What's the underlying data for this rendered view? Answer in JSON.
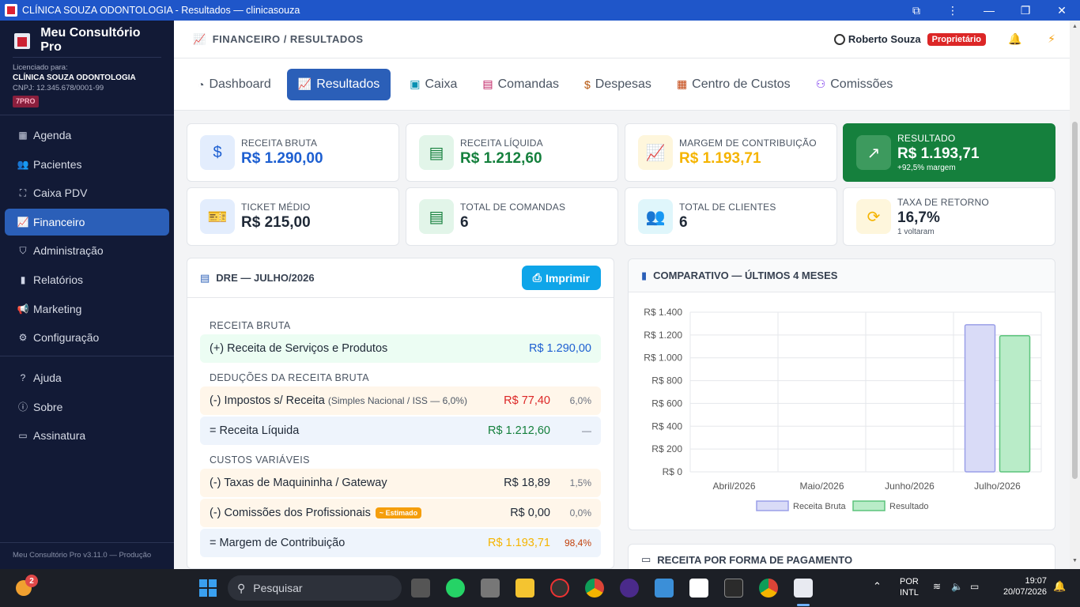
{
  "window": {
    "title": "CLÍNICA SOUZA ODONTOLOGIA - Resultados — clinicasouza"
  },
  "sidebar": {
    "brand": "Meu Consultório Pro",
    "license_label": "Licenciado para:",
    "clinic": "CLÍNICA SOUZA ODONTOLOGIA",
    "cnpj": "CNPJ: 12.345.678/0001-99",
    "plan": "7PRO",
    "items": [
      {
        "label": "Agenda",
        "icon": "calendar-icon"
      },
      {
        "label": "Pacientes",
        "icon": "users-icon"
      },
      {
        "label": "Caixa PDV",
        "icon": "cash-register-icon"
      },
      {
        "label": "Financeiro",
        "icon": "chart-line-icon"
      },
      {
        "label": "Administração",
        "icon": "shield-icon"
      },
      {
        "label": "Relatórios",
        "icon": "bar-chart-icon"
      },
      {
        "label": "Marketing",
        "icon": "megaphone-icon"
      },
      {
        "label": "Configuração",
        "icon": "gear-icon"
      }
    ],
    "items2": [
      {
        "label": "Ajuda",
        "icon": "help-icon"
      },
      {
        "label": "Sobre",
        "icon": "info-icon"
      },
      {
        "label": "Assinatura",
        "icon": "credit-card-icon"
      }
    ],
    "footer": "Meu Consultório Pro v3.11.0 — Produção"
  },
  "header": {
    "breadcrumb": "FINANCEIRO / RESULTADOS",
    "user": "Roberto Souza",
    "role": "Proprietário"
  },
  "tabs": [
    {
      "label": "Dashboard",
      "icon": "gauge-icon"
    },
    {
      "label": "Resultados",
      "icon": "chart-line-icon"
    },
    {
      "label": "Caixa",
      "icon": "money-icon"
    },
    {
      "label": "Comandas",
      "icon": "receipt-icon"
    },
    {
      "label": "Despesas",
      "icon": "bill-icon"
    },
    {
      "label": "Centro de Custos",
      "icon": "calculator-icon"
    },
    {
      "label": "Comissões",
      "icon": "user-cog-icon"
    }
  ],
  "cards": [
    {
      "label": "RECEITA BRUTA",
      "value": "R$ 1.290,00",
      "sub": "",
      "icon": "dollar-icon",
      "color": "#1d5fd1"
    },
    {
      "label": "RECEITA LÍQUIDA",
      "value": "R$ 1.212,60",
      "sub": "",
      "icon": "receipt-icon",
      "color": "#15803d"
    },
    {
      "label": "MARGEM DE CONTRIBUIÇÃO",
      "value": "R$ 1.193,71",
      "sub": "",
      "icon": "chart-line-icon",
      "color": "#f5b400"
    },
    {
      "label": "RESULTADO",
      "value": "R$ 1.193,71",
      "sub": "+92,5% margem",
      "icon": "trend-up-icon",
      "color": "#ffffff"
    },
    {
      "label": "TICKET MÉDIO",
      "value": "R$ 215,00",
      "sub": "",
      "icon": "ticket-icon",
      "color": "#1f2937"
    },
    {
      "label": "TOTAL DE COMANDAS",
      "value": "6",
      "sub": "",
      "icon": "receipt-icon",
      "color": "#1f2937"
    },
    {
      "label": "TOTAL DE CLIENTES",
      "value": "6",
      "sub": "",
      "icon": "users-icon",
      "color": "#1f2937"
    },
    {
      "label": "TAXA DE RETORNO",
      "value": "16,7%",
      "sub": "1 voltaram",
      "icon": "refresh-icon",
      "color": "#1f2937"
    }
  ],
  "dre": {
    "title": "DRE — JULHO/2026",
    "print": "Imprimir",
    "sec_receita": "RECEITA BRUTA",
    "receita_desc": "(+) Receita de Serviços e Produtos",
    "receita_val": "R$ 1.290,00",
    "sec_deducoes": "DEDUÇÕES DA RECEITA BRUTA",
    "impostos_desc": "(-) Impostos s/ Receita",
    "impostos_note": "(Simples Nacional / ISS — 6,0%)",
    "impostos_val": "R$ 77,40",
    "impostos_pct": "6,0%",
    "liquida_desc": "= Receita Líquida",
    "liquida_val": "R$ 1.212,60",
    "liquida_pct": "—",
    "sec_custos": "CUSTOS VARIÁVEIS",
    "taxas_desc": "(-) Taxas de Maquininha / Gateway",
    "taxas_val": "R$ 18,89",
    "taxas_pct": "1,5%",
    "comissoes_desc": "(-) Comissões dos Profissionais",
    "comissoes_chip": "~ Estimado",
    "comissoes_val": "R$ 0,00",
    "comissoes_pct": "0,0%",
    "margem_desc": "= Margem de Contribuição",
    "margem_val": "R$ 1.193,71",
    "margem_pct": "98,4%"
  },
  "comparativo": {
    "title": "COMPARATIVO — ÚLTIMOS 4 MESES"
  },
  "pagamento": {
    "title": "RECEITA POR FORMA DE PAGAMENTO"
  },
  "chart_data": {
    "type": "bar",
    "title": "",
    "categories": [
      "Abril/2026",
      "Maio/2026",
      "Junho/2026",
      "Julho/2026"
    ],
    "series": [
      {
        "name": "Receita Bruta",
        "values": [
          0,
          0,
          0,
          1290
        ],
        "fill": "#d9dbf7",
        "stroke": "#9a9fe8"
      },
      {
        "name": "Resultado",
        "values": [
          0,
          0,
          0,
          1193.71
        ],
        "fill": "#b9ecc8",
        "stroke": "#5cc47c"
      }
    ],
    "yticks": [
      "R$ 0",
      "R$ 200",
      "R$ 400",
      "R$ 600",
      "R$ 800",
      "R$ 1.000",
      "R$ 1.200",
      "R$ 1.400"
    ],
    "ylim": [
      0,
      1400
    ],
    "grid": true,
    "legend": "bottom"
  },
  "taskbar": {
    "notif_count": "2",
    "search": "Pesquisar",
    "lang1": "POR",
    "lang2": "INTL",
    "time": "19:07",
    "date": "20/07/2026"
  }
}
